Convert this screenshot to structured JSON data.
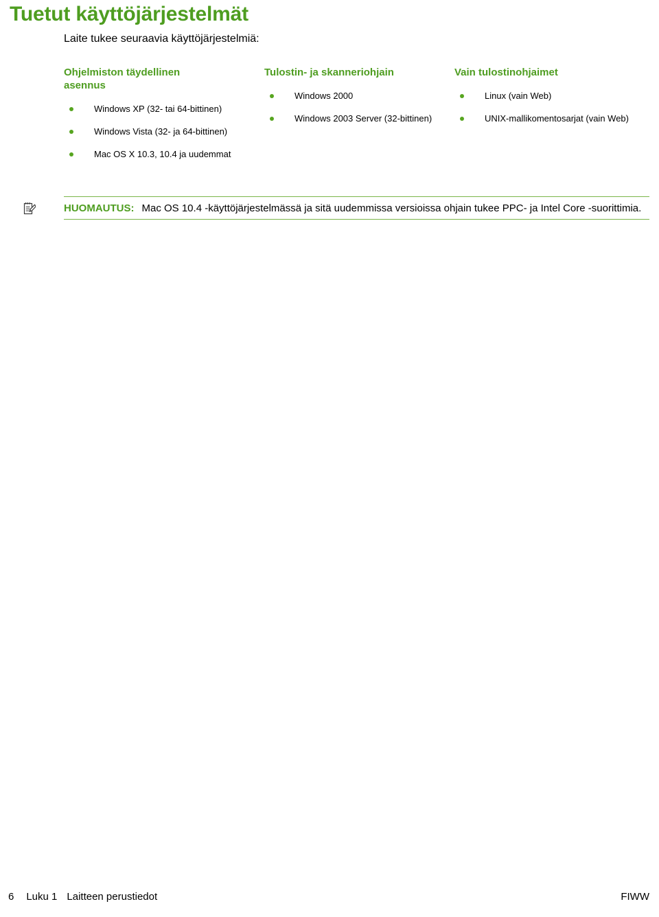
{
  "page": {
    "heading": "Tuetut käyttöjärjestelmät",
    "intro": "Laite tukee seuraavia käyttöjärjestelmiä:"
  },
  "columns": [
    {
      "title": "Ohjelmiston täydellinen asennus",
      "items": [
        "Windows XP (32- tai 64-bittinen)",
        "Windows Vista (32- ja 64-bittinen)",
        "Mac OS X 10.3, 10.4 ja uudemmat"
      ]
    },
    {
      "title": "Tulostin- ja skanneriohjain",
      "items": [
        "Windows 2000",
        "Windows 2003 Server (32-bittinen)"
      ]
    },
    {
      "title": "Vain tulostinohjaimet",
      "items": [
        "Linux (vain Web)",
        "UNIX-mallikomentosarjat (vain Web)"
      ]
    }
  ],
  "note": {
    "icon": "note-pencil-icon",
    "label": "HUOMAUTUS:",
    "text": "Mac OS 10.4 -käyttöjärjestelmässä ja sitä uudemmissa versioissa ohjain tukee PPC- ja Intel Core -suorittimia."
  },
  "footer": {
    "page_number": "6",
    "chapter": "Luku 1",
    "chapter_title": "Laitteen perustiedot",
    "right": "FIWW"
  },
  "colors": {
    "accent_green": "#4e9d20",
    "bullet_green": "#57a520",
    "rule_green": "#7ab648",
    "text_black": "#000000",
    "background": "#ffffff"
  }
}
